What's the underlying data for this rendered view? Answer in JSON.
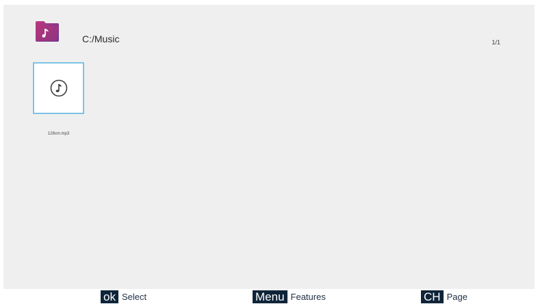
{
  "header": {
    "folder_icon": "music-folder-icon",
    "path": "C:/Music",
    "page_indicator": "1/1"
  },
  "files": [
    {
      "name": "128cm.mp3",
      "icon": "music-note-icon",
      "selected": true
    }
  ],
  "footer": {
    "ok_key": "ok",
    "ok_label": "Select",
    "menu_key": "Menu",
    "menu_label": "Features",
    "ch_key": "CH",
    "ch_label": "Page"
  },
  "colors": {
    "background": "#efefef",
    "selection_border": "#7cc3e6",
    "key_background": "#0f2438",
    "folder_pink": "#c0397f",
    "folder_purple": "#5e3593"
  }
}
